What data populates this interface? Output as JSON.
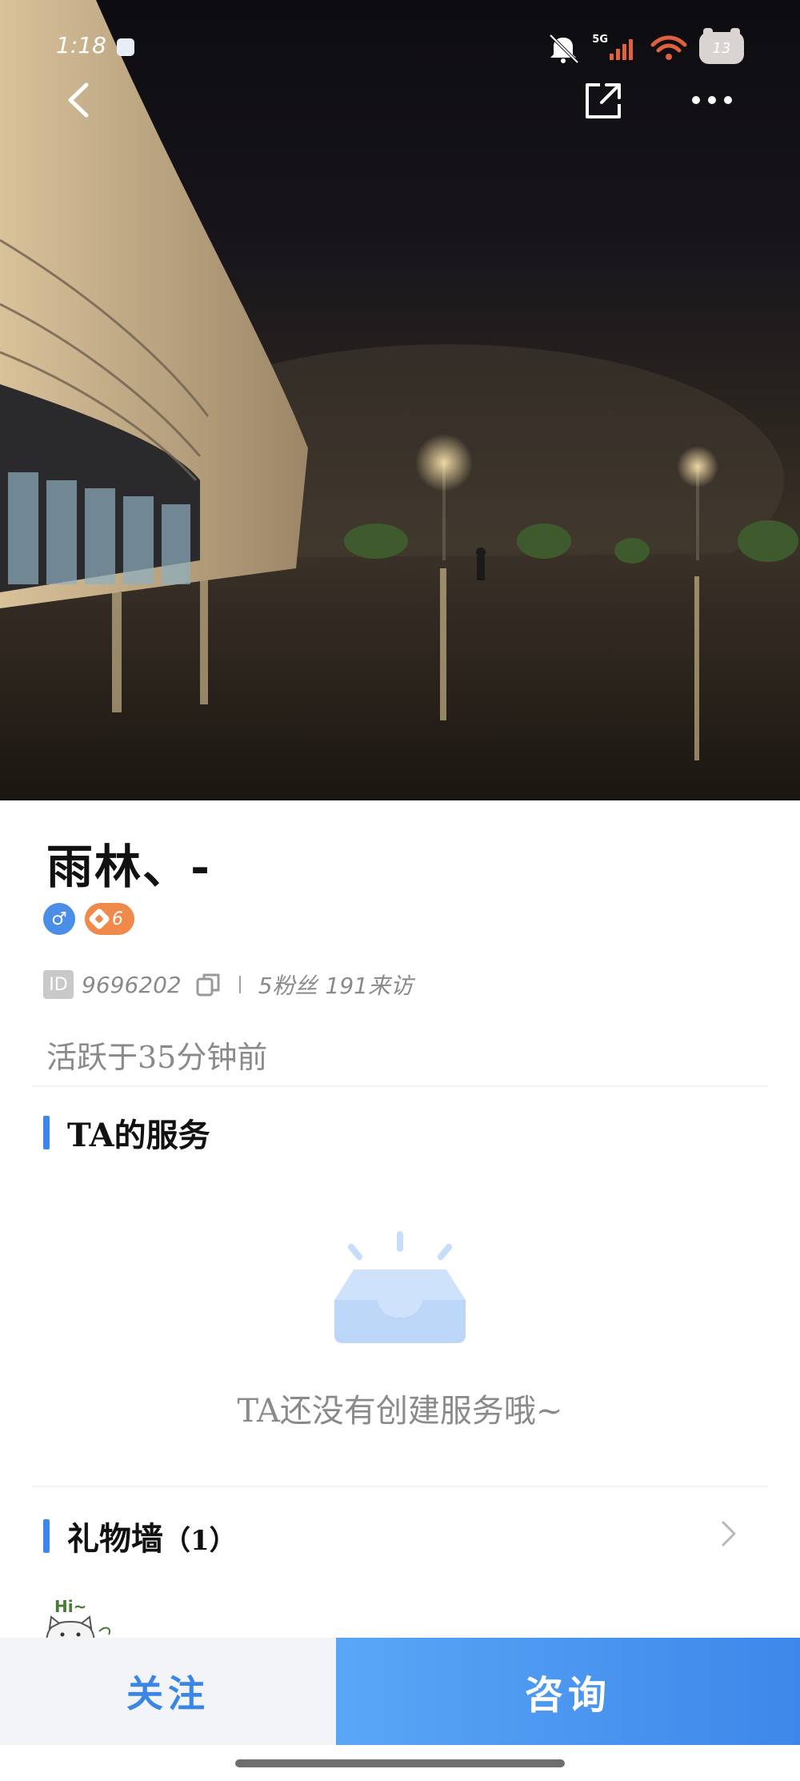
{
  "status_bar": {
    "time": "1:18",
    "network_label": "5G",
    "battery": "13",
    "icons": [
      "mute-bell-icon",
      "signal-icon",
      "wifi-icon",
      "battery-icon"
    ]
  },
  "nav": {
    "icons": [
      "back-icon",
      "share-icon",
      "more-icon"
    ]
  },
  "profile": {
    "name": "雨林、-",
    "gender_symbol": "♂",
    "level": "6",
    "id_label": "ID",
    "id_value": "9696202",
    "followers": "5粉丝",
    "visits": "191来访",
    "active": "活跃于35分钟前"
  },
  "services": {
    "title": "TA的服务",
    "empty_text": "TA还没有创建服务哦~"
  },
  "gift_wall": {
    "title": "礼物墙",
    "count": "（1）",
    "sticker_text": "Hi~"
  },
  "bottom_bar": {
    "follow_label": "关注",
    "consult_label": "咨询"
  },
  "colors": {
    "accent": "#3d86ea",
    "level_badge": "#f08a4b",
    "follow_bg": "#f3f4f8"
  }
}
